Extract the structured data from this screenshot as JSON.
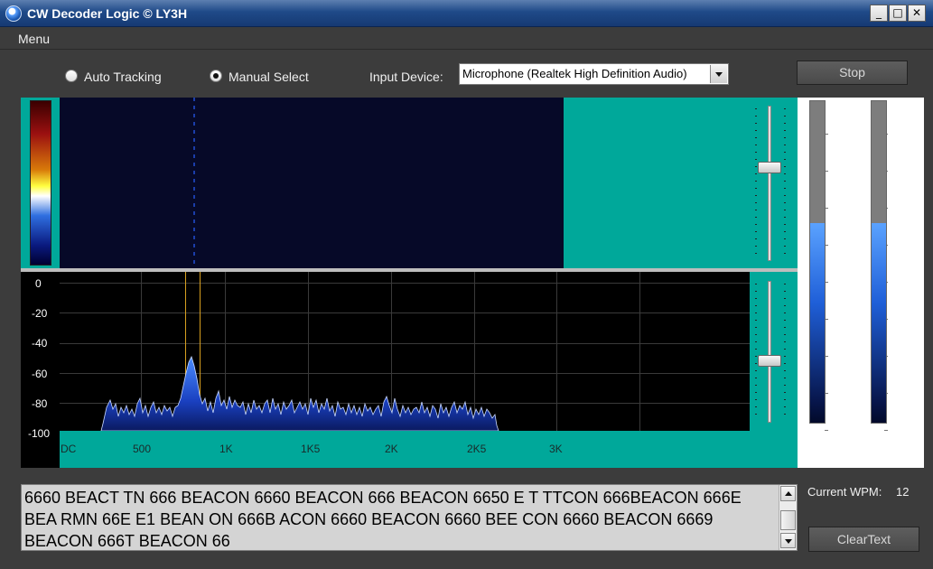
{
  "window": {
    "title": "CW Decoder Logic © LY3H",
    "minimize": "_",
    "maximize": "□",
    "close": "✕"
  },
  "menu": {
    "items": [
      "Menu"
    ]
  },
  "toolbar": {
    "auto_tracking_label": "Auto Tracking",
    "manual_select_label": "Manual Select",
    "selected_mode": "Manual Select",
    "input_device_label": "Input Device:",
    "input_device_value": "Microphone (Realtek High Definition Audio)",
    "stop_label": "Stop"
  },
  "spectrum": {
    "db_labels": [
      "0",
      "-20",
      "-40",
      "-60",
      "-80",
      "-100"
    ],
    "freq_labels": [
      "DC",
      "500",
      "1K",
      "1K5",
      "2K",
      "2K5",
      "3K"
    ],
    "marker_color": "#d8a020",
    "trace_color": "#2a6cff"
  },
  "waterfall": {
    "colors": [
      "#3a0000",
      "#d87a0a",
      "#ffff40",
      "#ffffff",
      "#2f6fe0",
      "#000030"
    ]
  },
  "meters": {
    "level_left": 0.62,
    "level_right": 0.62
  },
  "decoder": {
    "text": "6660 BEACT TN 666 BEACON 6660 BEACON 666 BEACON 6650 E T TTCON 666BEACON 666E BEA RMN 66E E1 BEAN ON 666B ACON 6660 BEACON 6660 BEE CON 6660 BEACON 6669 BEACON 666T BEACON 66",
    "wpm_label": "Current WPM:",
    "wpm_value": "12",
    "clear_label": "ClearText"
  },
  "colors": {
    "accent_teal": "#00a89a",
    "background": "#3c3c3c"
  }
}
